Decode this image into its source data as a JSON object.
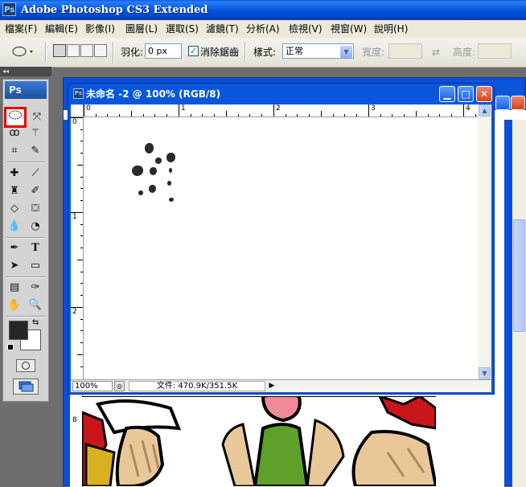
{
  "app": {
    "title": "Adobe Photoshop CS3 Extended",
    "icon": "Ps"
  },
  "menu": [
    "檔案(F)",
    "編輯(E)",
    "影像(I)",
    "圖層(L)",
    "選取(S)",
    "濾鏡(T)",
    "分析(A)",
    "檢視(V)",
    "視窗(W)",
    "說明(H)"
  ],
  "options": {
    "feather_label": "羽化:",
    "feather_value": "0 px",
    "antialias_label": "消除鋸齒",
    "antialias_checked": true,
    "style_label": "樣式:",
    "style_value": "正常",
    "width_label": "寬度:",
    "height_label": "高度:"
  },
  "tools": {
    "logo": "Ps",
    "grip": "◂◂"
  },
  "document": {
    "title": "未命名 -2 @ 100% (RGB/8)",
    "icon": "Ps",
    "zoom": "100%",
    "file_info": "文件: 470.9K/351.5K",
    "ruler_h": [
      "0",
      "1",
      "2",
      "3",
      "4"
    ],
    "ruler_v": [
      "0",
      "1",
      "2"
    ]
  },
  "back_document": {
    "ruler_v": [
      "8"
    ]
  },
  "colors": {
    "title_blue": "#0355e0",
    "selection_red": "#e80000"
  }
}
